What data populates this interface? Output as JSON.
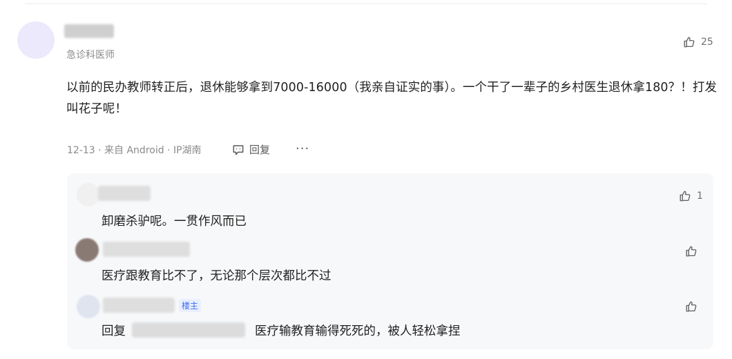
{
  "comment": {
    "author_title": "急诊科医师",
    "like_count": "25",
    "text": "以前的民办教师转正后，退休能够拿到7000-16000（我亲自证实的事）。一个干了一辈子的乡村医生退休拿180？！打发叫花子呢！",
    "meta": "12-13 · 来自 Android · IP湖南",
    "reply_label": "回复",
    "more_label": "···"
  },
  "replies": [
    {
      "text": "卸磨杀驴呢。一贯作风而已",
      "like_count": "1"
    },
    {
      "text": "医疗跟教育比不了，无论那个层次都比不过",
      "like_count": ""
    },
    {
      "badge": "楼主",
      "reply_prefix": "回复",
      "text": "医疗输教育输得死死的，被人轻松拿捏",
      "like_count": ""
    }
  ],
  "colors": {
    "accent": "#3f6ef0",
    "reply_bg": "#f7f8fa",
    "muted": "#8a8a8a"
  },
  "icons": [
    "thumbs-up-icon",
    "comment-bubble-icon",
    "more-dots-icon"
  ]
}
